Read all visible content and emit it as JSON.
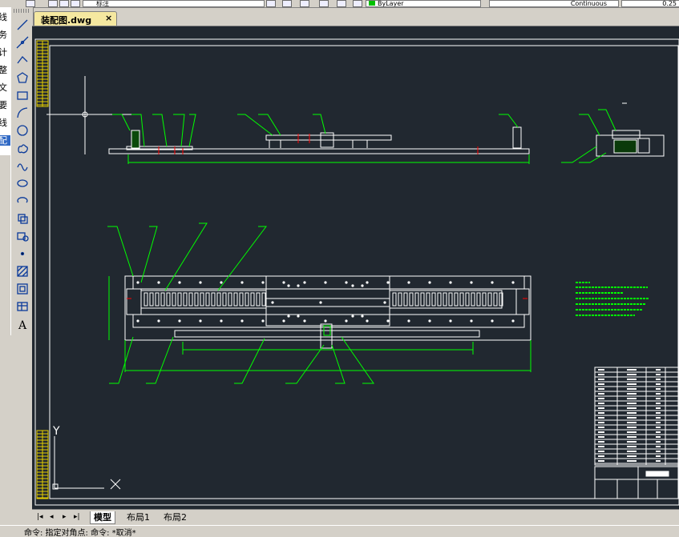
{
  "toolbar": {
    "layer_name": "标注",
    "color_value": "ByLayer",
    "linetype_value": "Continuous",
    "lineweight_value": "0.25"
  },
  "left_strip": [
    "线",
    "务",
    "计",
    "整",
    "文",
    "要",
    "线",
    "配"
  ],
  "drawing_tools": [
    "line-icon",
    "construction-line-icon",
    "polyline-icon",
    "polygon-icon",
    "rectangle-icon",
    "arc-icon",
    "circle-icon",
    "revision-cloud-icon",
    "spline-icon",
    "ellipse-icon",
    "ellipse-arc-icon",
    "insert-block-icon",
    "make-block-icon",
    "point-icon",
    "hatch-icon",
    "region-icon",
    "table-icon",
    "multiline-text-icon"
  ],
  "file_tab": {
    "name": "装配图.dwg",
    "close": "×"
  },
  "layout_tabs": [
    "模型",
    "布局1",
    "布局2"
  ],
  "active_layout": "模型",
  "nav_buttons": [
    "|◂",
    "◂",
    "▸",
    "▸|"
  ],
  "ucs": {
    "y": "Y"
  },
  "drawing": {
    "line_color": "#00ff00",
    "object_color": "#ffffff",
    "dimension_color": "#00ff00",
    "accent_color": "#ff0000",
    "background": "#212830"
  },
  "status_text": "命令: 指定对角点: 命令: *取消*"
}
